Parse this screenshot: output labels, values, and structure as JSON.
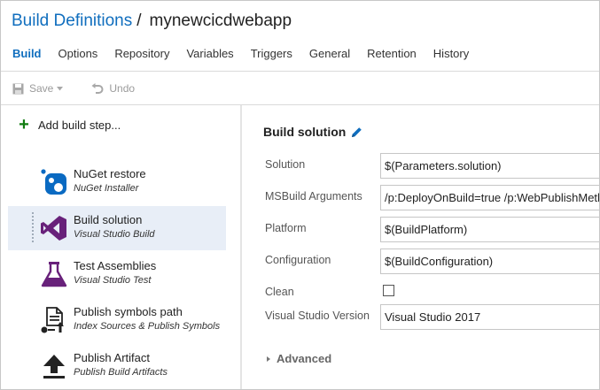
{
  "header": {
    "breadcrumb_link": "Build Definitions",
    "separator": "/",
    "definition_name": "mynewcicdwebapp"
  },
  "tabs": [
    {
      "label": "Build",
      "active": true
    },
    {
      "label": "Options",
      "active": false
    },
    {
      "label": "Repository",
      "active": false
    },
    {
      "label": "Variables",
      "active": false
    },
    {
      "label": "Triggers",
      "active": false
    },
    {
      "label": "General",
      "active": false
    },
    {
      "label": "Retention",
      "active": false
    },
    {
      "label": "History",
      "active": false
    }
  ],
  "toolbar": {
    "save_label": "Save",
    "undo_label": "Undo"
  },
  "steps_panel": {
    "add_label": "Add build step...",
    "steps": [
      {
        "name": "NuGet restore",
        "subtitle": "NuGet Installer",
        "icon": "nuget-icon",
        "selected": false
      },
      {
        "name": "Build solution",
        "subtitle": "Visual Studio Build",
        "icon": "visual-studio-icon",
        "selected": true
      },
      {
        "name": "Test Assemblies",
        "subtitle": "Visual Studio Test",
        "icon": "flask-icon",
        "selected": false
      },
      {
        "name": "Publish symbols path",
        "subtitle": "Index Sources & Publish Symbols",
        "icon": "publish-symbols-icon",
        "selected": false
      },
      {
        "name": "Publish Artifact",
        "subtitle": "Publish Build Artifacts",
        "icon": "upload-icon",
        "selected": false
      }
    ]
  },
  "task": {
    "title": "Build solution",
    "fields": [
      {
        "label": "Solution",
        "value": "$(Parameters.solution)",
        "type": "text"
      },
      {
        "label": "MSBuild Arguments",
        "value": "/p:DeployOnBuild=true /p:WebPublishMethod",
        "type": "text"
      },
      {
        "label": "Platform",
        "value": "$(BuildPlatform)",
        "type": "text"
      },
      {
        "label": "Configuration",
        "value": "$(BuildConfiguration)",
        "type": "text"
      },
      {
        "label": "Clean",
        "checked": false,
        "type": "checkbox"
      },
      {
        "label": "Visual Studio Version",
        "value": "Visual Studio 2017",
        "type": "select"
      }
    ],
    "advanced_label": "Advanced"
  },
  "colors": {
    "accent": "#106ebe",
    "add_plus": "#107c10",
    "selected_row": "#e8eef7",
    "nuget_blue": "#0a6ac2",
    "vs_purple": "#68217a"
  }
}
